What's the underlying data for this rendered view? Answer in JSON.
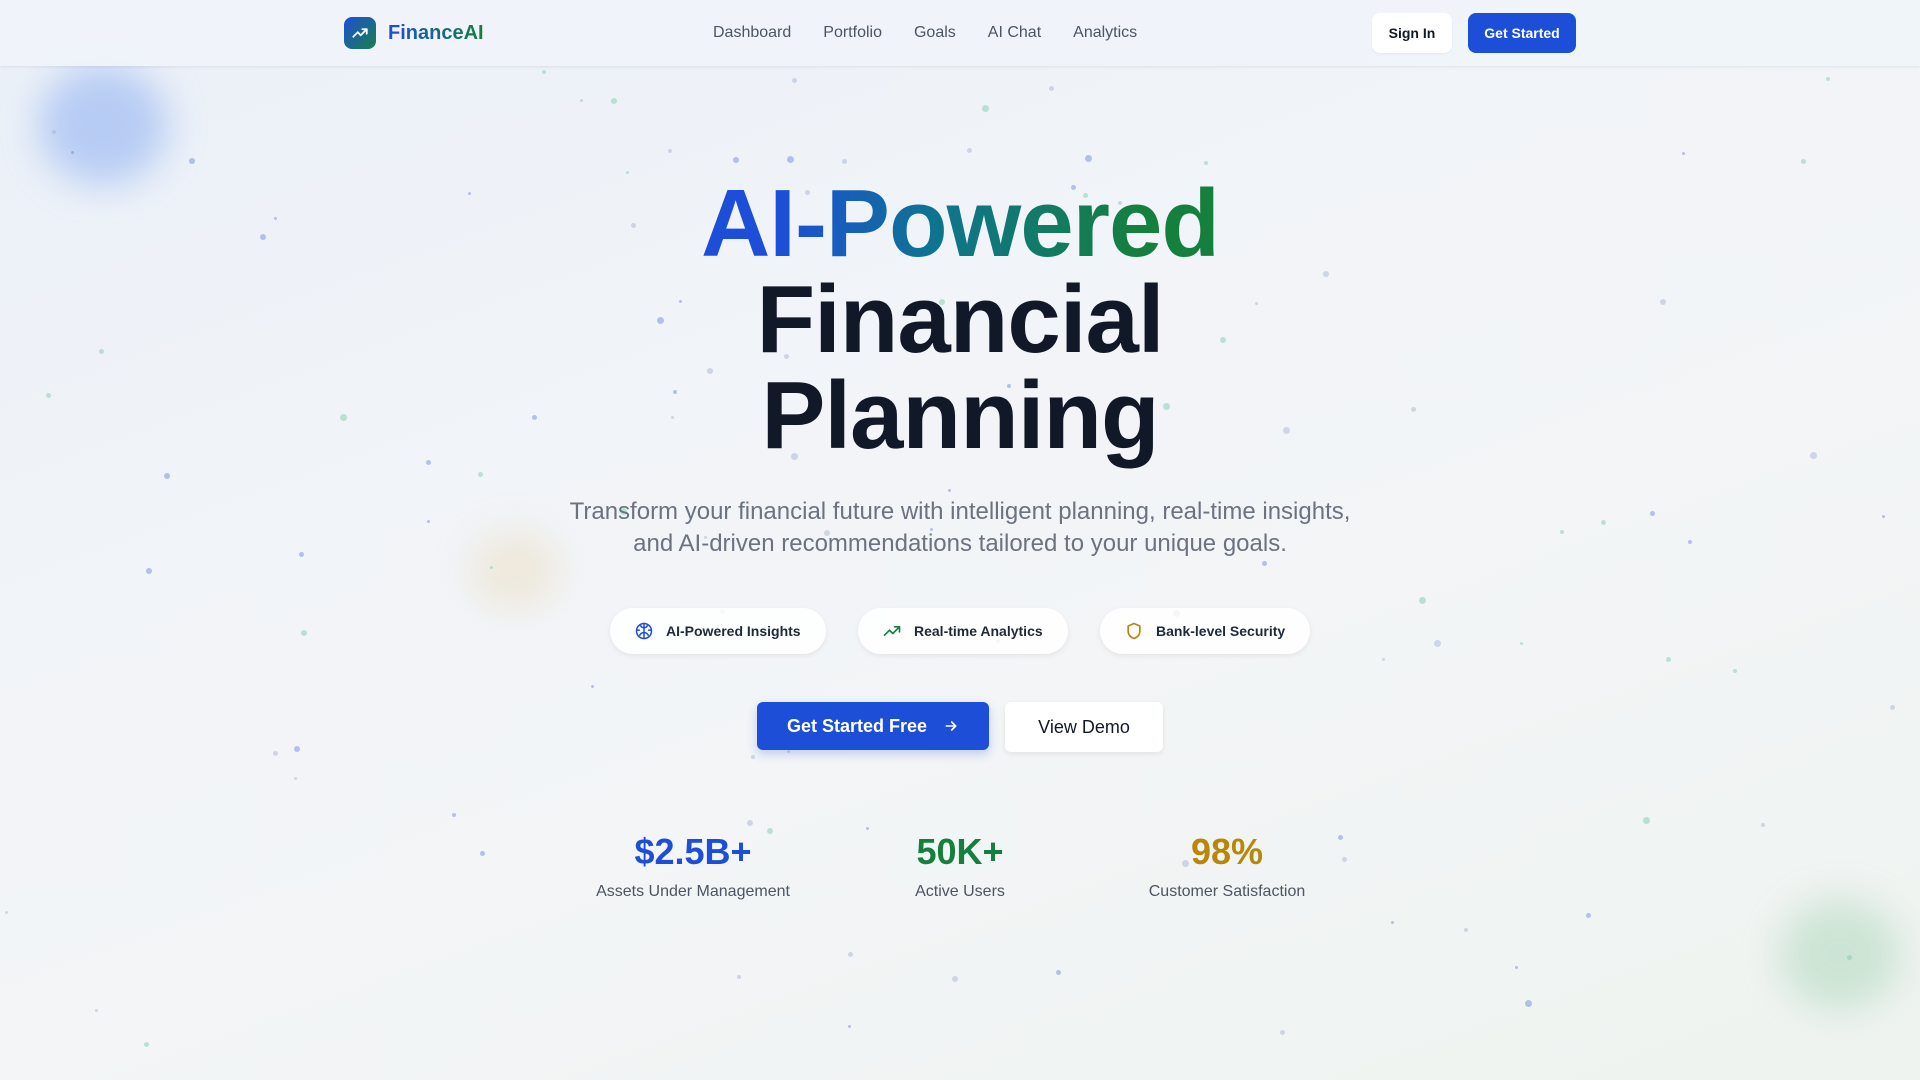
{
  "brand": {
    "name": "FinanceAI",
    "logo_icon": "trending-up-icon"
  },
  "nav": {
    "items": [
      "Dashboard",
      "Portfolio",
      "Goals",
      "AI Chat",
      "Analytics"
    ]
  },
  "header_actions": {
    "sign_in": "Sign In",
    "get_started": "Get Started"
  },
  "hero": {
    "title_line1": "AI-Powered",
    "title_line2": "Financial",
    "title_line3": "Planning",
    "subtitle": "Transform your financial future with intelligent planning, real-time insights, and AI-driven recommendations tailored to your unique goals."
  },
  "features": [
    {
      "label": "AI-Powered Insights",
      "icon": "brain-icon",
      "color": "#1d4ed8"
    },
    {
      "label": "Real-time Analytics",
      "icon": "trending-up-icon",
      "color": "#15803d"
    },
    {
      "label": "Bank-level Security",
      "icon": "shield-icon",
      "color": "#b7860b"
    }
  ],
  "cta": {
    "primary": "Get Started Free",
    "secondary": "View Demo"
  },
  "stats": [
    {
      "value": "$2.5B+",
      "label": "Assets Under Management",
      "color": "#1d4ed8"
    },
    {
      "value": "50K+",
      "label": "Active Users",
      "color": "#15803d"
    },
    {
      "value": "98%",
      "label": "Customer Satisfaction",
      "color": "#b7860b"
    }
  ],
  "colors": {
    "primary": "#1d4ed8",
    "green": "#15803d",
    "amber": "#b7860b",
    "text_dark": "#111827",
    "text_muted": "#6b7280"
  }
}
